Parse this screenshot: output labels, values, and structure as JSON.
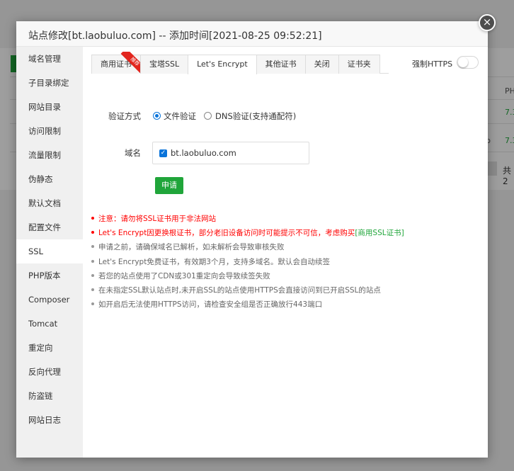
{
  "background": {
    "col_header": "PH",
    "row1_val": "7.3",
    "row2_val": "7.3",
    "row2_partial": "p",
    "total_partial": "共2"
  },
  "modal": {
    "title": "站点修改[bt.laobuluo.com] -- 添加时间[2021-08-25 09:52:21]",
    "close": "×"
  },
  "sidebar": {
    "items": [
      {
        "label": "域名管理"
      },
      {
        "label": "子目录绑定"
      },
      {
        "label": "网站目录"
      },
      {
        "label": "访问限制"
      },
      {
        "label": "流量限制"
      },
      {
        "label": "伪静态"
      },
      {
        "label": "默认文档"
      },
      {
        "label": "配置文件"
      },
      {
        "label": "SSL"
      },
      {
        "label": "PHP版本"
      },
      {
        "label": "Composer"
      },
      {
        "label": "Tomcat"
      },
      {
        "label": "重定向"
      },
      {
        "label": "反向代理"
      },
      {
        "label": "防盗链"
      },
      {
        "label": "网站日志"
      }
    ],
    "active_index": 8
  },
  "tabs": [
    {
      "label": "商用证书",
      "ribbon": "推荐"
    },
    {
      "label": "宝塔SSL"
    },
    {
      "label": "Let's Encrypt"
    },
    {
      "label": "其他证书"
    },
    {
      "label": "关闭"
    },
    {
      "label": "证书夹"
    }
  ],
  "force_https": {
    "label": "强制HTTPS",
    "enabled": false
  },
  "form": {
    "method_label": "验证方式",
    "method_options": [
      {
        "label": "文件验证",
        "checked": true
      },
      {
        "label": "DNS验证(支持通配符)",
        "checked": false
      }
    ],
    "domain_label": "域名",
    "domain_value": "bt.laobuluo.com",
    "domain_checked": true,
    "apply_button": "申请"
  },
  "notes": {
    "n1": "注意：请勿将SSL证书用于非法网站",
    "n2_text": "Let's Encrypt因更换根证书，部分老旧设备访问时可能提示不可信，考虑购买",
    "n2_link": "[商用SSL证书]",
    "n3": "申请之前，请确保域名已解析，如未解析会导致审核失败",
    "n4": "Let's Encrypt免费证书，有效期3个月，支持多域名。默认会自动续签",
    "n5": "若您的站点使用了CDN或301重定向会导致续签失败",
    "n6": "在未指定SSL默认站点时,未开启SSL的站点使用HTTPS会直接访问到已开启SSL的站点",
    "n7": "如开启后无法使用HTTPS访问，请检查安全组是否正确放行443端口"
  },
  "colors": {
    "brand_green": "#20a53a",
    "warning_red": "#ff0000",
    "radio_blue": "#0a74da"
  }
}
